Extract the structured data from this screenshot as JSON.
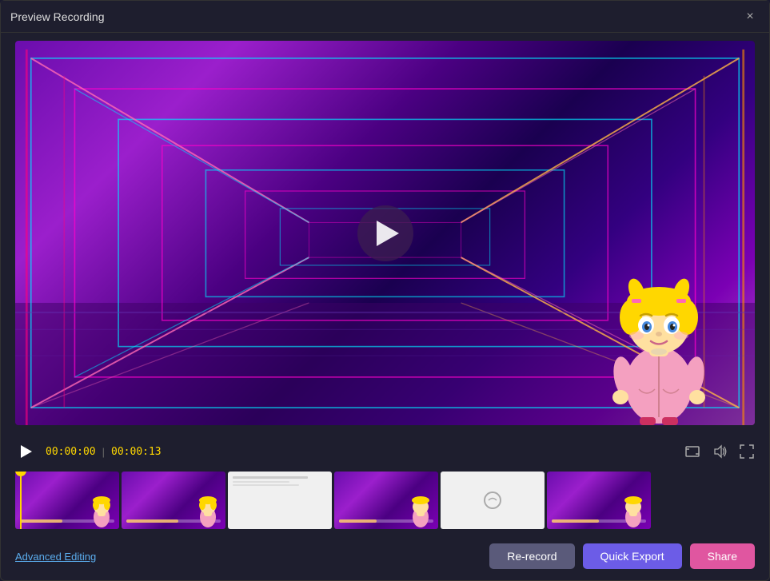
{
  "window": {
    "title": "Preview Recording",
    "close_button_label": "×"
  },
  "video": {
    "time_current": "00:00:00",
    "time_separator": "|",
    "time_total": "00:00:13"
  },
  "controls": {
    "fullscreen_icon": "⛶",
    "volume_icon": "🔊",
    "expand_icon": "⤢"
  },
  "filmstrip": {
    "thumbs": [
      {
        "type": "neon",
        "fill_pct": 45
      },
      {
        "type": "neon",
        "fill_pct": 55
      },
      {
        "type": "white",
        "fill_pct": 0
      },
      {
        "type": "neon",
        "fill_pct": 40
      },
      {
        "type": "white_blank",
        "fill_pct": 0
      },
      {
        "type": "neon",
        "fill_pct": 50
      }
    ]
  },
  "footer": {
    "advanced_editing": "Advanced Editing",
    "rerecord_label": "Re-record",
    "quick_export_label": "Quick Export",
    "share_label": "Share"
  }
}
